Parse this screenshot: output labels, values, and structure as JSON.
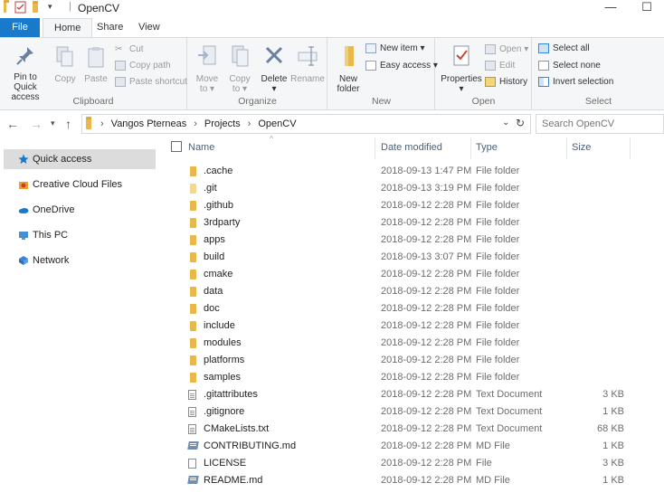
{
  "window": {
    "title": "OpenCV",
    "minimize": "—",
    "maximize": "☐"
  },
  "tabs": [
    {
      "label": "File"
    },
    {
      "label": "Home"
    },
    {
      "label": "Share"
    },
    {
      "label": "View"
    }
  ],
  "ribbon": {
    "clipboard": {
      "label": "Clipboard",
      "pin_line1": "Pin to Quick",
      "pin_line2": "access",
      "copy": "Copy",
      "paste": "Paste",
      "cut": "Cut",
      "copy_path": "Copy path",
      "paste_shortcut": "Paste shortcut"
    },
    "organize": {
      "label": "Organize",
      "move_to_1": "Move",
      "move_to_2": "to",
      "copy_to_1": "Copy",
      "copy_to_2": "to",
      "delete": "Delete",
      "rename": "Rename"
    },
    "new": {
      "label": "New",
      "new_folder_1": "New",
      "new_folder_2": "folder",
      "new_item": "New item",
      "easy_access": "Easy access"
    },
    "open": {
      "label": "Open",
      "properties": "Properties",
      "open": "Open",
      "edit": "Edit",
      "history": "History"
    },
    "select": {
      "label": "Select",
      "select_all": "Select all",
      "select_none": "Select none",
      "invert": "Invert selection"
    }
  },
  "address": {
    "crumbs": [
      "Vangos Pterneas",
      "Projects",
      "OpenCV"
    ],
    "search_placeholder": "Search OpenCV"
  },
  "nav_pane": [
    {
      "label": "Quick access",
      "icon": "star-icon",
      "color": "#1979ca"
    },
    {
      "label": "Creative Cloud Files",
      "icon": "creative-cloud-icon",
      "color": "#e8a030"
    },
    {
      "label": "OneDrive",
      "icon": "onedrive-icon",
      "color": "#1979ca"
    },
    {
      "label": "This PC",
      "icon": "computer-icon",
      "color": "#4a90d0"
    },
    {
      "label": "Network",
      "icon": "network-icon",
      "color": "#3a86d0"
    }
  ],
  "columns": {
    "name": "Name",
    "date": "Date modified",
    "type": "Type",
    "size": "Size"
  },
  "files": [
    {
      "name": ".cache",
      "date": "2018-09-13 1:47 PM",
      "type": "File folder",
      "size": "",
      "icon": "folder"
    },
    {
      "name": ".git",
      "date": "2018-09-13 3:19 PM",
      "type": "File folder",
      "size": "",
      "icon": "folder-light"
    },
    {
      "name": ".github",
      "date": "2018-09-12 2:28 PM",
      "type": "File folder",
      "size": "",
      "icon": "folder"
    },
    {
      "name": "3rdparty",
      "date": "2018-09-12 2:28 PM",
      "type": "File folder",
      "size": "",
      "icon": "folder"
    },
    {
      "name": "apps",
      "date": "2018-09-12 2:28 PM",
      "type": "File folder",
      "size": "",
      "icon": "folder"
    },
    {
      "name": "build",
      "date": "2018-09-13 3:07 PM",
      "type": "File folder",
      "size": "",
      "icon": "folder"
    },
    {
      "name": "cmake",
      "date": "2018-09-12 2:28 PM",
      "type": "File folder",
      "size": "",
      "icon": "folder"
    },
    {
      "name": "data",
      "date": "2018-09-12 2:28 PM",
      "type": "File folder",
      "size": "",
      "icon": "folder"
    },
    {
      "name": "doc",
      "date": "2018-09-12 2:28 PM",
      "type": "File folder",
      "size": "",
      "icon": "folder"
    },
    {
      "name": "include",
      "date": "2018-09-12 2:28 PM",
      "type": "File folder",
      "size": "",
      "icon": "folder"
    },
    {
      "name": "modules",
      "date": "2018-09-12 2:28 PM",
      "type": "File folder",
      "size": "",
      "icon": "folder"
    },
    {
      "name": "platforms",
      "date": "2018-09-12 2:28 PM",
      "type": "File folder",
      "size": "",
      "icon": "folder"
    },
    {
      "name": "samples",
      "date": "2018-09-12 2:28 PM",
      "type": "File folder",
      "size": "",
      "icon": "folder"
    },
    {
      "name": ".gitattributes",
      "date": "2018-09-12 2:28 PM",
      "type": "Text Document",
      "size": "3 KB",
      "icon": "doc"
    },
    {
      "name": ".gitignore",
      "date": "2018-09-12 2:28 PM",
      "type": "Text Document",
      "size": "1 KB",
      "icon": "doc"
    },
    {
      "name": "CMakeLists.txt",
      "date": "2018-09-12 2:28 PM",
      "type": "Text Document",
      "size": "68 KB",
      "icon": "doc"
    },
    {
      "name": "CONTRIBUTING.md",
      "date": "2018-09-12 2:28 PM",
      "type": "MD File",
      "size": "1 KB",
      "icon": "md"
    },
    {
      "name": "LICENSE",
      "date": "2018-09-12 2:28 PM",
      "type": "File",
      "size": "3 KB",
      "icon": "blank"
    },
    {
      "name": "README.md",
      "date": "2018-09-12 2:28 PM",
      "type": "MD File",
      "size": "1 KB",
      "icon": "md"
    }
  ],
  "colors": {
    "accent": "#1979ca",
    "folder": "#e8b84a",
    "selection": "#dcdcdc"
  }
}
